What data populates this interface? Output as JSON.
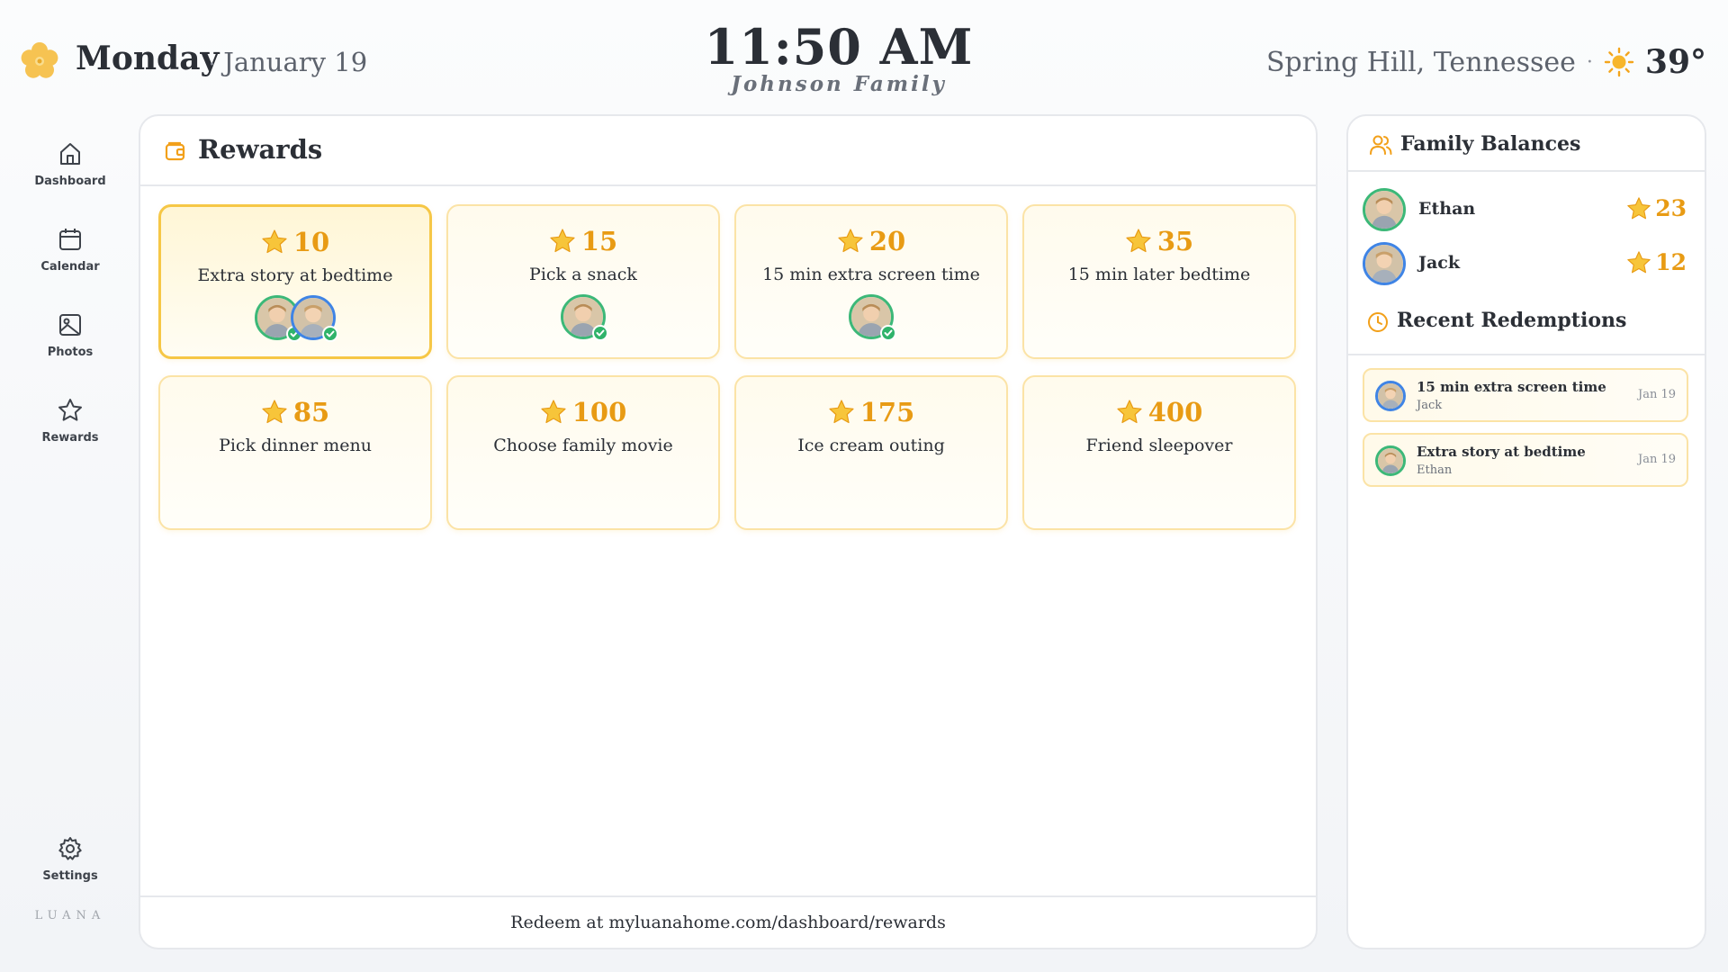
{
  "header": {
    "day": "Monday",
    "separator": "·",
    "date": "January 19",
    "time": "11:50 AM",
    "family": "Johnson Family",
    "location": "Spring Hill, Tennessee",
    "temperature": "39°",
    "weather_icon": "sun-icon",
    "logo_icon": "flower-icon"
  },
  "nav": {
    "items": [
      {
        "label": "Dashboard",
        "icon": "home-icon"
      },
      {
        "label": "Calendar",
        "icon": "calendar-icon"
      },
      {
        "label": "Photos",
        "icon": "image-icon"
      },
      {
        "label": "Rewards",
        "icon": "star-icon"
      }
    ],
    "settings": {
      "label": "Settings",
      "icon": "gear-icon"
    },
    "brand": "LUANA"
  },
  "rewards": {
    "title": "Rewards",
    "footer": "Redeem at myluanahome.com/dashboard/rewards",
    "items": [
      {
        "points": "10",
        "title": "Extra story at bedtime",
        "selected": true,
        "redeemed_by": [
          "Ethan",
          "Jack"
        ]
      },
      {
        "points": "15",
        "title": "Pick a snack",
        "selected": false,
        "redeemed_by": [
          "Ethan"
        ]
      },
      {
        "points": "20",
        "title": "15 min extra screen time",
        "selected": false,
        "redeemed_by": [
          "Ethan"
        ]
      },
      {
        "points": "35",
        "title": "15 min later bedtime",
        "selected": false,
        "redeemed_by": []
      },
      {
        "points": "85",
        "title": "Pick dinner menu",
        "selected": false,
        "redeemed_by": []
      },
      {
        "points": "100",
        "title": "Choose family movie",
        "selected": false,
        "redeemed_by": []
      },
      {
        "points": "175",
        "title": "Ice cream outing",
        "selected": false,
        "redeemed_by": []
      },
      {
        "points": "400",
        "title": "Friend sleepover",
        "selected": false,
        "redeemed_by": []
      }
    ]
  },
  "balances": {
    "title": "Family Balances",
    "members": [
      {
        "name": "Ethan",
        "balance": "23",
        "ring_color": "#3cb878"
      },
      {
        "name": "Jack",
        "balance": "12",
        "ring_color": "#3f84e5"
      }
    ]
  },
  "recent": {
    "title": "Recent Redemptions",
    "items": [
      {
        "reward": "15 min extra screen time",
        "member": "Jack",
        "date": "Jan 19"
      },
      {
        "reward": "Extra story at bedtime",
        "member": "Ethan",
        "date": "Jan 19"
      }
    ]
  },
  "colors": {
    "accent_gold": "#e89b14",
    "card_border": "#fbe3a6",
    "selected_border": "#f6c746",
    "check_green": "#2fb36a"
  }
}
